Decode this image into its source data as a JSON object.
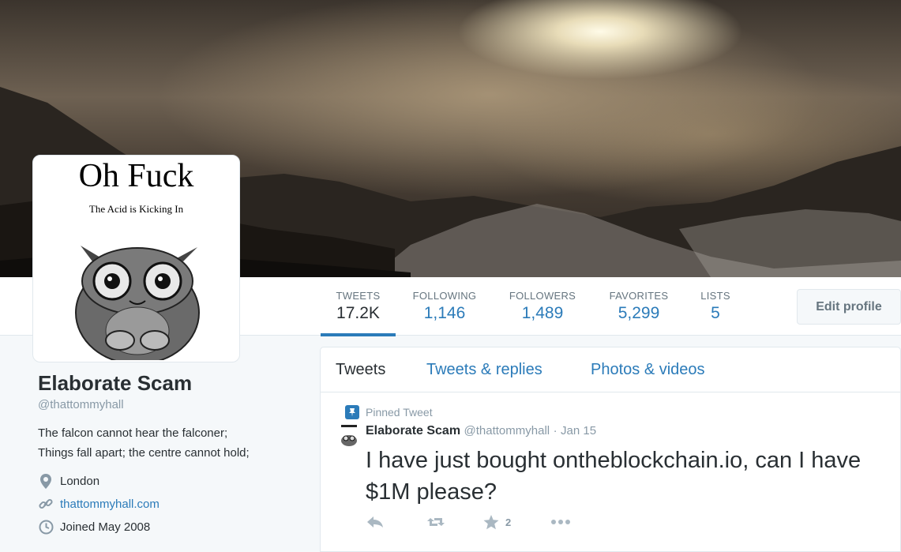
{
  "avatar": {
    "title": "Oh Fuck",
    "subtitle": "The Acid is Kicking In"
  },
  "stats": [
    {
      "label": "TWEETS",
      "value": "17.2K",
      "active": true
    },
    {
      "label": "FOLLOWING",
      "value": "1,146"
    },
    {
      "label": "FOLLOWERS",
      "value": "1,489"
    },
    {
      "label": "FAVORITES",
      "value": "5,299"
    },
    {
      "label": "LISTS",
      "value": "5"
    }
  ],
  "edit_profile_label": "Edit profile",
  "profile": {
    "name": "Elaborate Scam",
    "handle": "@thattommyhall",
    "bio_line1": "The falcon cannot hear the falconer;",
    "bio_line2": "Things fall apart; the centre cannot hold;",
    "location": "London",
    "website": "thattommyhall.com",
    "joined": "Joined May 2008"
  },
  "tabs": [
    {
      "label": "Tweets",
      "active": true
    },
    {
      "label": "Tweets & replies"
    },
    {
      "label": "Photos & videos"
    }
  ],
  "tweet": {
    "pinned_label": "Pinned Tweet",
    "author": "Elaborate Scam",
    "handle": "@thattommyhall",
    "separator": "·",
    "date": "Jan 15",
    "text": "I have just bought ontheblockchain.io, can I have $1M please?",
    "favorite_count": "2"
  },
  "colors": {
    "accent": "#2b7bb9",
    "text": "#292f33",
    "muted": "#8899a6"
  },
  "icons": [
    "location-pin-icon",
    "link-icon",
    "calendar-clock-icon",
    "pin-icon",
    "reply-icon",
    "retweet-icon",
    "star-icon",
    "more-icon"
  ]
}
